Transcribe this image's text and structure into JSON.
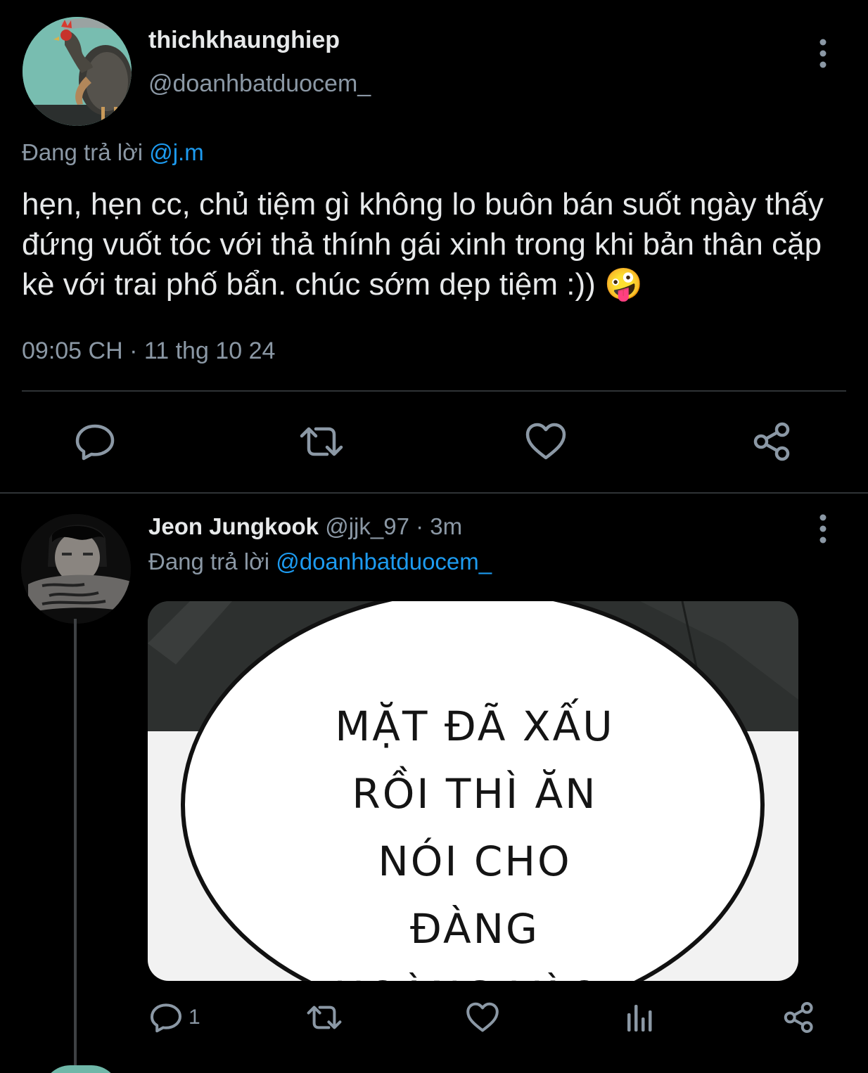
{
  "main_tweet": {
    "author_name": "thichkhaunghiep",
    "author_handle": "@doanhbatduocem_",
    "replying_prefix": "Đang trả lời",
    "replying_to": "@j.m",
    "text": "hẹn, hẹn cc, chủ tiệm gì không lo buôn bán suốt ngày thấy đứng vuốt tóc với thả thính gái xinh trong khi bản thân cặp kè với trai phố bẩn. chúc sớm dẹp tiệm :)) 🤪",
    "timestamp": "09:05 CH · 11 thg 10 24",
    "actions": [
      "comment-icon",
      "retweet-icon",
      "heart-icon",
      "share-icon"
    ]
  },
  "reply_tweet": {
    "author_name": "Jeon Jungkook",
    "author_handle": "@jjk_97",
    "separator": "·",
    "time_ago": "3m",
    "replying_prefix": "Đang trả lời",
    "replying_to": "@doanhbatduocem_",
    "media_text": "MẶT ĐÃ XẤU RỒI THÌ ĂN NÓI CHO ĐÀNG HOÀNG VÀO.",
    "reply_count": "1",
    "actions": [
      "comment-icon",
      "retweet-icon",
      "heart-icon",
      "analytics-icon",
      "share-icon"
    ]
  },
  "colors": {
    "background": "#000000",
    "text": "#e7e9ea",
    "muted": "#8b98a5",
    "link": "#1d9bf0",
    "divider": "#2f3336"
  }
}
